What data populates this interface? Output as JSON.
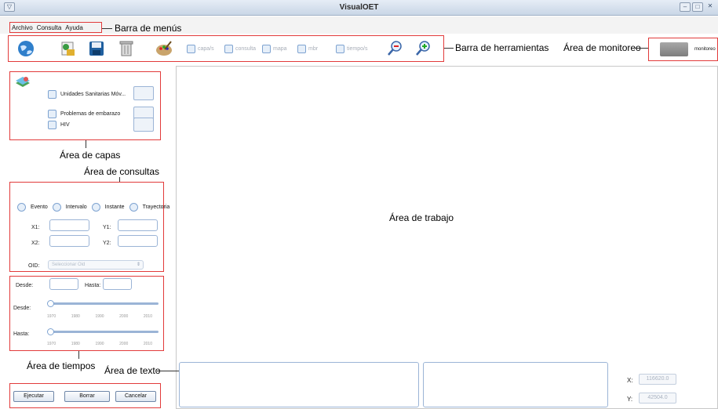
{
  "window": {
    "title": "VisualOET"
  },
  "menu": {
    "items": [
      "Archivo",
      "Consulta",
      "Ayuda"
    ]
  },
  "callouts": {
    "menubar": "Barra de menús",
    "toolbar": "Barra de herramientas",
    "monitor": "Área de monitoreo",
    "layers": "Área de capas",
    "queries": "Área de consultas",
    "work": "Área de trabajo",
    "times": "Área de tiempos",
    "text": "Área de texto"
  },
  "toolbar": {
    "icons": [
      "globe-icon",
      "add-layer-icon",
      "save-icon",
      "trash-icon",
      "palette-icon",
      "zoom-out-icon",
      "zoom-in-icon"
    ],
    "checks": [
      "capa/s",
      "consulta",
      "mapa",
      "mbr",
      "tiempo/s"
    ]
  },
  "monitor": {
    "label": "monitoreo"
  },
  "layers": {
    "items": [
      {
        "label": "Unidades Sanitarias Móv...",
        "checked": false
      },
      {
        "label": "Problemas de embarazo",
        "checked": false
      },
      {
        "label": "HIV",
        "checked": false
      }
    ]
  },
  "query": {
    "options": [
      "Evento",
      "Intervalo",
      "Instante",
      "Trayectoria"
    ],
    "x1": "X1:",
    "y1": "Y1:",
    "x2": "X2:",
    "y2": "Y2:",
    "oid_label": "OID:",
    "oid_placeholder": "Seleccionar Oid"
  },
  "times": {
    "from": "Desde:",
    "to": "Hasta:",
    "slider_from": "Desde:",
    "slider_to": "Hasta:",
    "ticks": [
      "1970",
      "1980",
      "1990",
      "2000",
      "2010"
    ]
  },
  "actions": {
    "run": "Ejecutar",
    "clear": "Borrar",
    "cancel": "Cancelar"
  },
  "coords": {
    "x_label": "X:",
    "x_value": "116620.0",
    "y_label": "Y:",
    "y_value": "42504.0"
  },
  "colors": {
    "callout_box": "#e23b3b",
    "field_border": "#9bb4d6"
  }
}
